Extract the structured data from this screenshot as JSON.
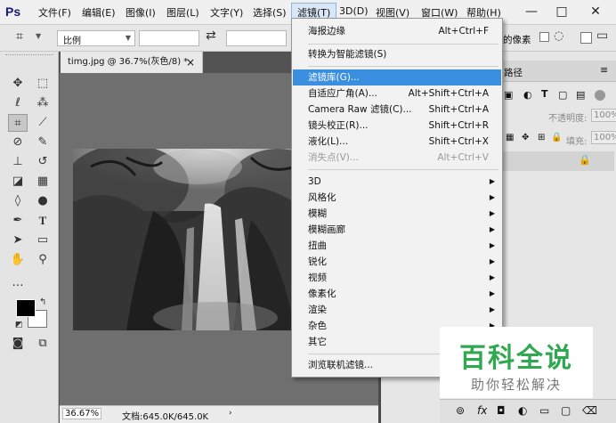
{
  "app": {
    "logo": "Ps"
  },
  "menubar": {
    "items": [
      "文件(F)",
      "编辑(E)",
      "图像(I)",
      "图层(L)",
      "文字(Y)",
      "选择(S)",
      "滤镜(T)",
      "3D(D)",
      "视图(V)",
      "窗口(W)",
      "帮助(H)"
    ],
    "window_buttons": [
      "—",
      "□",
      "✕"
    ]
  },
  "options": {
    "ratio_select": "比例",
    "swap_icon": "⇄",
    "right_text": "的像素"
  },
  "document": {
    "tab_title": "timg.jpg @ 36.7%(灰色/8) *",
    "tab_close": "×",
    "zoom": "36.67%",
    "doc_info": "文档:645.0K/645.0K"
  },
  "right_panel": {
    "tab_label": "路径",
    "opacity_label": "不透明度:",
    "opacity_value": "100%",
    "fill_label": "填充:",
    "fill_value": "100%"
  },
  "filter_menu": {
    "items": [
      {
        "label": "海报边缘",
        "shortcut": "Alt+Ctrl+F"
      },
      {
        "label": "转换为智能滤镜(S)",
        "shortcut": ""
      },
      {
        "label": "滤镜库(G)...",
        "shortcut": ""
      },
      {
        "label": "自适应广角(A)...",
        "shortcut": "Alt+Shift+Ctrl+A"
      },
      {
        "label": "Camera Raw 滤镜(C)...",
        "shortcut": "Shift+Ctrl+A"
      },
      {
        "label": "镜头校正(R)...",
        "shortcut": "Shift+Ctrl+R"
      },
      {
        "label": "液化(L)...",
        "shortcut": "Shift+Ctrl+X"
      },
      {
        "label": "消失点(V)...",
        "shortcut": "Alt+Ctrl+V"
      },
      {
        "label": "3D",
        "shortcut": ""
      },
      {
        "label": "风格化",
        "shortcut": ""
      },
      {
        "label": "模糊",
        "shortcut": ""
      },
      {
        "label": "模糊画廊",
        "shortcut": ""
      },
      {
        "label": "扭曲",
        "shortcut": ""
      },
      {
        "label": "锐化",
        "shortcut": ""
      },
      {
        "label": "视频",
        "shortcut": ""
      },
      {
        "label": "像素化",
        "shortcut": ""
      },
      {
        "label": "渲染",
        "shortcut": ""
      },
      {
        "label": "杂色",
        "shortcut": ""
      },
      {
        "label": "其它",
        "shortcut": ""
      },
      {
        "label": "浏览联机滤镜...",
        "shortcut": ""
      }
    ],
    "submenu_arrow": "▶"
  },
  "watermark": {
    "title": "百科全说",
    "subtitle": "助你轻松解决"
  },
  "colors": {
    "highlight": "#3b8fe0",
    "watermark_green": "#2fa84f"
  },
  "icons": [
    "crop-icon",
    "move-icon",
    "marquee-icon",
    "lasso-icon",
    "magic-wand-icon",
    "eyedropper-icon",
    "healing-brush-icon",
    "brush-icon",
    "stamp-icon",
    "history-brush-icon",
    "eraser-icon",
    "gradient-icon",
    "blur-icon",
    "dodge-icon",
    "pen-icon",
    "type-icon",
    "path-select-icon",
    "rectangle-icon",
    "hand-icon",
    "zoom-icon",
    "lock-icon"
  ]
}
